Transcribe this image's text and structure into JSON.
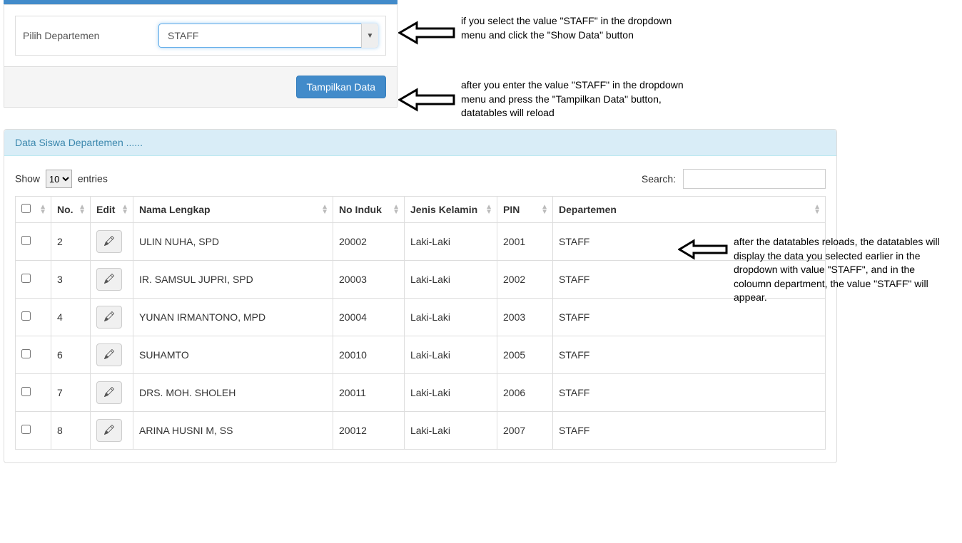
{
  "filter": {
    "label": "Pilih Departemen",
    "selected": "STAFF",
    "button": "Tampilkan Data"
  },
  "annotations": {
    "a1": "if you select the value \"STAFF\" in the dropdown menu and click the \"Show Data\" button",
    "a2": "after you enter the value \"STAFF\" in the dropdown menu and press the \"Tampilkan Data\" button, datatables will reload",
    "a3": "after the datatables reloads, the datatables will display the data you selected earlier in the dropdown with value \"STAFF\", and in the coloumn department, the value \"STAFF\" will appear."
  },
  "panel": {
    "title": "Data Siswa Departemen ......"
  },
  "datatable": {
    "length_label_pre": "Show",
    "length_label_post": "entries",
    "length_value": "10",
    "search_label": "Search:",
    "search_value": "",
    "columns": {
      "check": "",
      "no": "No.",
      "edit": "Edit",
      "nama": "Nama Lengkap",
      "induk": "No Induk",
      "jk": "Jenis Kelamin",
      "pin": "PIN",
      "dept": "Departemen"
    },
    "rows": [
      {
        "no": "2",
        "nama": "ULIN NUHA, SPD",
        "induk": "20002",
        "jk": "Laki-Laki",
        "pin": "2001",
        "dept": "STAFF"
      },
      {
        "no": "3",
        "nama": "IR. SAMSUL JUPRI, SPD",
        "induk": "20003",
        "jk": "Laki-Laki",
        "pin": "2002",
        "dept": "STAFF"
      },
      {
        "no": "4",
        "nama": "YUNAN IRMANTONO, MPD",
        "induk": "20004",
        "jk": "Laki-Laki",
        "pin": "2003",
        "dept": "STAFF"
      },
      {
        "no": "6",
        "nama": "SUHAMTO",
        "induk": "20010",
        "jk": "Laki-Laki",
        "pin": "2005",
        "dept": "STAFF"
      },
      {
        "no": "7",
        "nama": "DRS. MOH. SHOLEH",
        "induk": "20011",
        "jk": "Laki-Laki",
        "pin": "2006",
        "dept": "STAFF"
      },
      {
        "no": "8",
        "nama": "ARINA HUSNI M, SS",
        "induk": "20012",
        "jk": "Laki-Laki",
        "pin": "2007",
        "dept": "STAFF"
      }
    ]
  }
}
